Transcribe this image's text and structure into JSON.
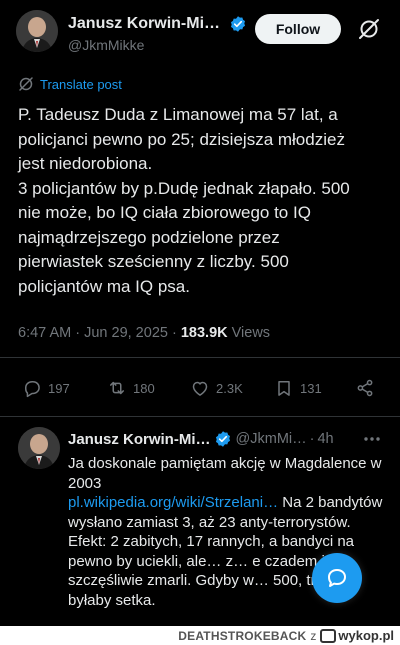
{
  "post": {
    "author": {
      "display_name": "Janusz Korwin-Mik…",
      "handle": "@JkmMikke",
      "verified": true
    },
    "follow_label": "Follow",
    "translate_label": "Translate post",
    "text_lines": [
      "P. Tadeusz Duda z Limanowej ma 57 lat, a",
      "policjanci pewno po 25; dzisiejsza młodzież",
      "jest niedorobiona.",
      "3 policjantów by p.Dudę jednak złapało. 500",
      "nie może, bo IQ ciała zbiorowego to IQ",
      "najmądrzejszego podzielone przez",
      "pierwiastek sześcienny z liczby. 500",
      "policjantów ma IQ psa."
    ],
    "time": "6:47 AM",
    "date": "Jun 29, 2025",
    "views_count": "183.9K",
    "views_label": "Views",
    "stats": {
      "replies": "197",
      "reposts": "180",
      "likes": "2.3K",
      "bookmarks": "131"
    }
  },
  "reply": {
    "display_name": "Janusz Korwin-Mi…",
    "handle": "@JkmMi…",
    "time": "4h",
    "text_before_link": "Ja doskonale pamiętam akcję w Magdalence w 2003",
    "link": "pl.wikipedia.org/wiki/Strzelani…",
    "text_after_link": " Na 2 bandytów wysłano zamiast 3, aż 23 anty-terrorystów. Efekt: 2 zabitych, 17 rannych, a bandyci na pewno by uciekli, ale… z… e czadem i szczęśliwie zmarli. Gdyby w… 500, trupów byłaby setka."
  },
  "footer": {
    "username": "DEATHSTROKEBACK",
    "separator": "z",
    "brand": "wykop.pl"
  },
  "colors": {
    "accent": "#1d9bf0",
    "background": "#000000",
    "text": "#e7e9ea",
    "muted": "#71767b"
  }
}
